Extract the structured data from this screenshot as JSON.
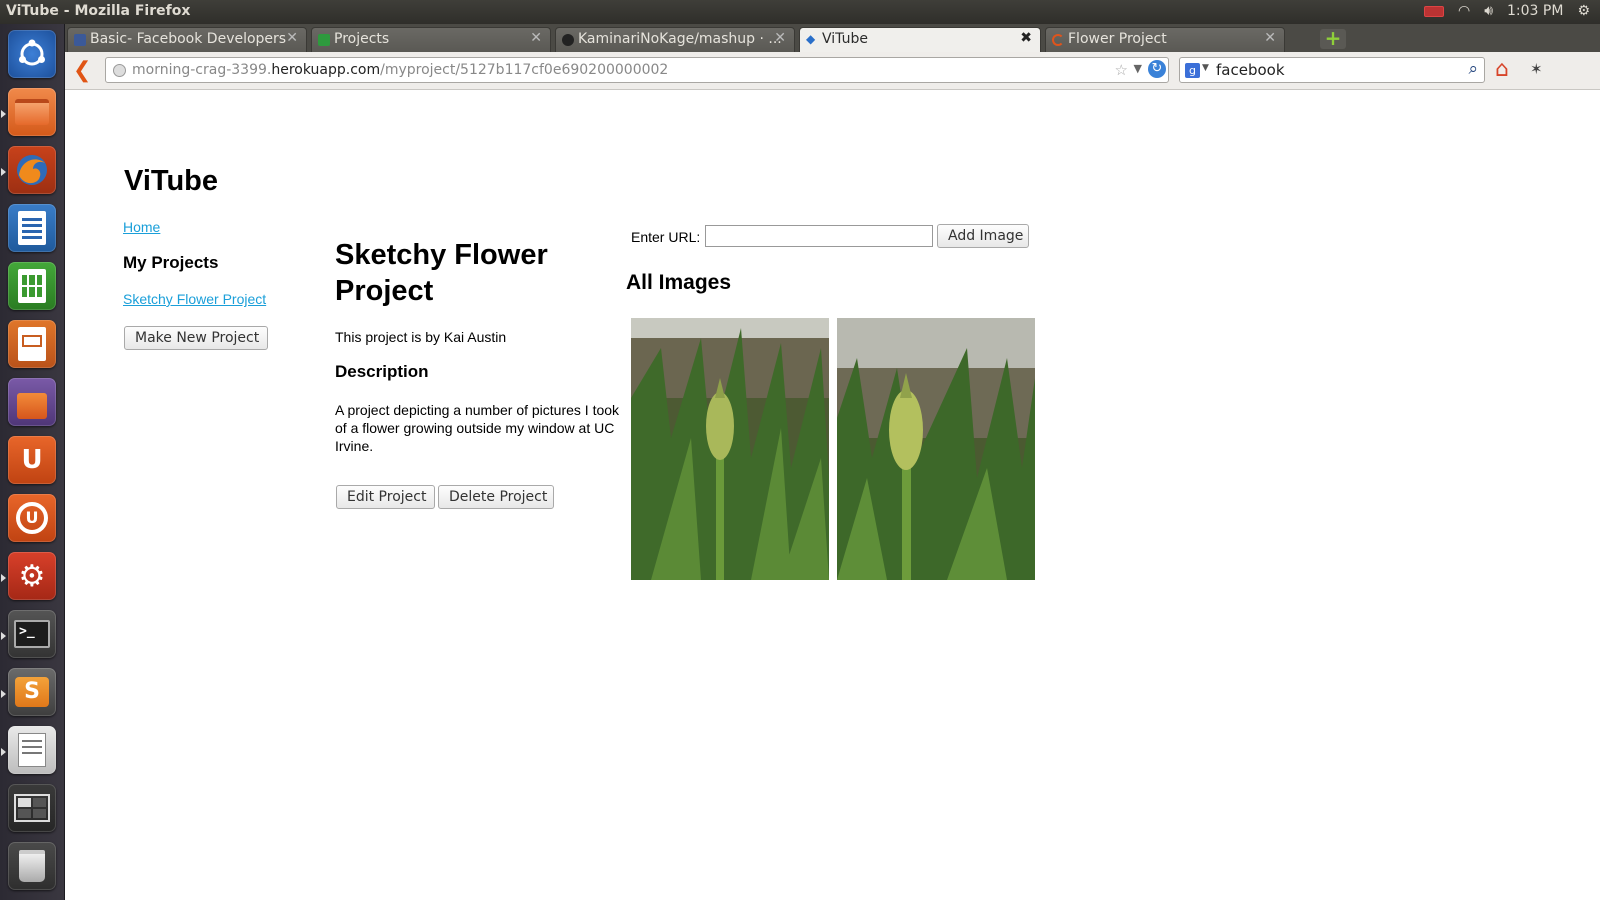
{
  "os": {
    "window_title": "ViTube - Mozilla Firefox",
    "clock": "1:03 PM",
    "launcher_icons": [
      "ubuntu-dash-icon",
      "files-icon",
      "firefox-icon",
      "writer-icon",
      "calc-icon",
      "impress-icon",
      "software-center-icon",
      "ubuntu-one-icon",
      "ubuntu-one-music-icon",
      "system-settings-icon",
      "terminal-icon",
      "sublime-text-icon",
      "text-editor-icon",
      "workspace-switcher-icon",
      "trash-icon"
    ]
  },
  "browser": {
    "tabs": [
      {
        "label": "Basic- Facebook Developers",
        "active": false
      },
      {
        "label": "Projects",
        "active": false
      },
      {
        "label": "KaminariNoKage/mashup · ...",
        "active": false
      },
      {
        "label": "ViTube",
        "active": true
      },
      {
        "label": "Flower Project",
        "active": false
      }
    ],
    "url_prefix": "morning-crag-3399.",
    "url_host": "herokuapp.com",
    "url_path": "/myproject/5127b117cf0e690200000002",
    "search_value": "facebook"
  },
  "page": {
    "site_title": "ViTube",
    "nav": {
      "home_link": "Home",
      "my_projects_heading": "My Projects",
      "project_link": "Sketchy Flower Project",
      "new_project_button": "Make New Project"
    },
    "project": {
      "title": "Sketchy Flower Project",
      "byline": "This project is by Kai Austin",
      "description_heading": "Description",
      "description": "A project depicting a number of pictures I took of a flower growing outside my window at UC Irvine.",
      "edit_button": "Edit Project",
      "delete_button": "Delete Project"
    },
    "images": {
      "url_label": "Enter URL:",
      "url_value": "",
      "add_button": "Add Image",
      "heading": "All Images",
      "items": [
        "flower-photo-1",
        "flower-photo-2"
      ]
    }
  }
}
